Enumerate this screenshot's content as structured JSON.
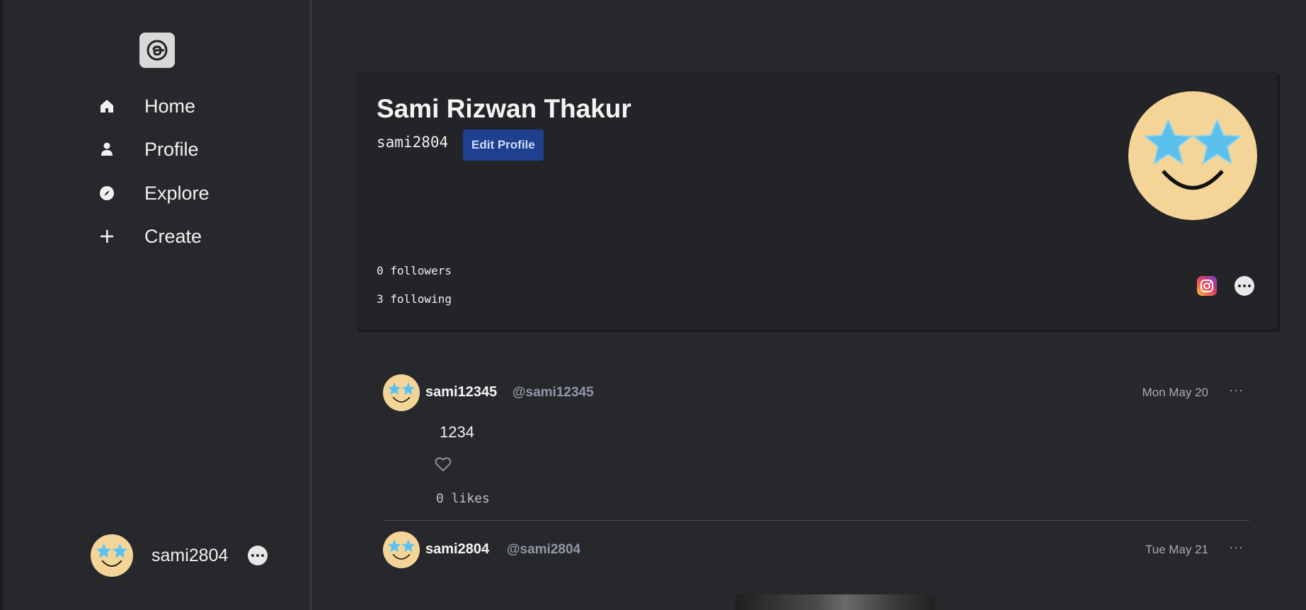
{
  "sidebar": {
    "logo_icon": "threads-logo-icon",
    "nav": [
      {
        "label": "Home",
        "icon": "home-icon"
      },
      {
        "label": "Profile",
        "icon": "person-icon"
      },
      {
        "label": "Explore",
        "icon": "compass-icon"
      },
      {
        "label": "Create",
        "icon": "plus-icon"
      }
    ],
    "user": {
      "username": "sami2804",
      "menu_icon": "more-dots-icon"
    }
  },
  "profile": {
    "name": "Sami Rizwan Thakur",
    "handle": "sami2804",
    "edit_button": "Edit Profile",
    "followers": "0 followers",
    "following": "3 following",
    "social_icon": "instagram-icon",
    "more_icon": "more-dots-icon"
  },
  "posts": [
    {
      "username": "sami12345",
      "handle": "@sami12345",
      "date": "Mon May 20",
      "more": "···",
      "text": "1234",
      "likes": "0 likes"
    },
    {
      "username": "sami2804",
      "handle": "@sami2804",
      "date": "Tue May 21",
      "more": "···"
    }
  ],
  "colors": {
    "background": "#27282b",
    "card": "#232427",
    "accent": "#1f3f8f"
  }
}
